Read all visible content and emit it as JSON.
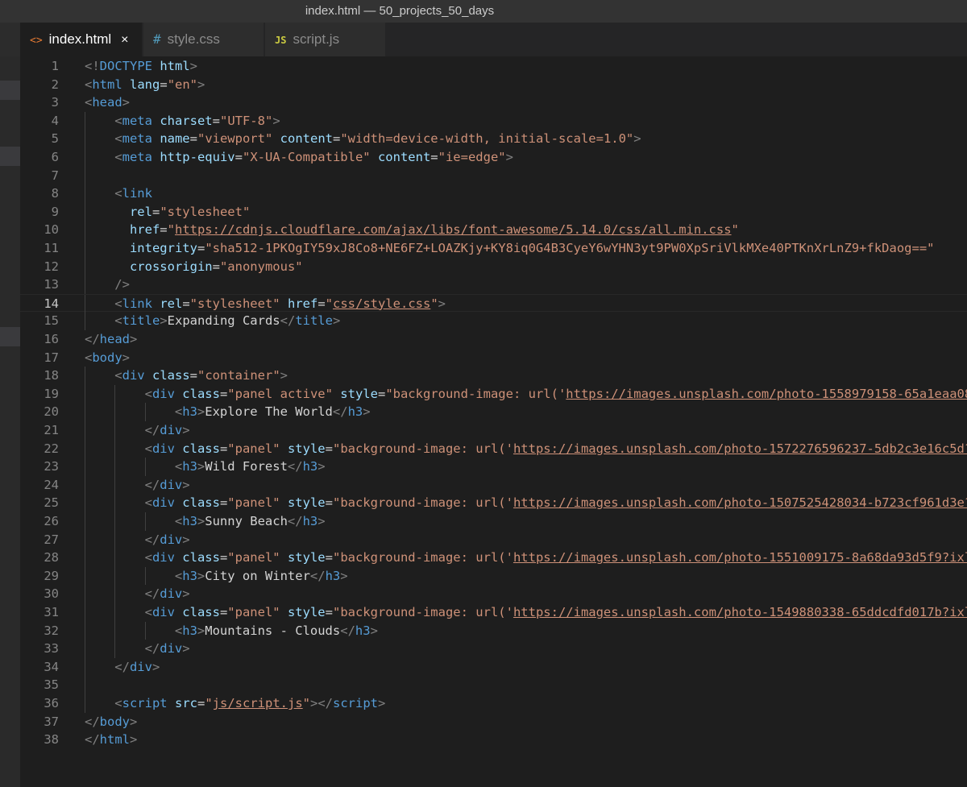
{
  "window": {
    "title": "index.html — 50_projects_50_days"
  },
  "tabs": [
    {
      "label": "index.html",
      "icon": "<>",
      "icon_name": "html-file-icon",
      "active": true,
      "close": "×"
    },
    {
      "label": "style.css",
      "icon": "#",
      "icon_name": "css-file-icon",
      "active": false
    },
    {
      "label": "script.js",
      "icon": "JS",
      "icon_name": "js-file-icon",
      "active": false
    }
  ],
  "editor": {
    "current_line": 14,
    "lines": [
      {
        "n": "1",
        "indent": 0,
        "tokens": [
          [
            "punct",
            "<!"
          ],
          [
            "tag",
            "DOCTYPE"
          ],
          [
            "text",
            " "
          ],
          [
            "attr",
            "html"
          ],
          [
            "punct",
            ">"
          ]
        ]
      },
      {
        "n": "2",
        "indent": 0,
        "tokens": [
          [
            "punct",
            "<"
          ],
          [
            "tag",
            "html"
          ],
          [
            "text",
            " "
          ],
          [
            "attr",
            "lang"
          ],
          [
            "text",
            "="
          ],
          [
            "str",
            "\"en\""
          ],
          [
            "punct",
            ">"
          ]
        ]
      },
      {
        "n": "3",
        "indent": 0,
        "tokens": [
          [
            "punct",
            "<"
          ],
          [
            "tag",
            "head"
          ],
          [
            "punct",
            ">"
          ]
        ]
      },
      {
        "n": "4",
        "indent": 1,
        "tokens": [
          [
            "punct",
            "<"
          ],
          [
            "tag",
            "meta"
          ],
          [
            "text",
            " "
          ],
          [
            "attr",
            "charset"
          ],
          [
            "text",
            "="
          ],
          [
            "str",
            "\"UTF-8\""
          ],
          [
            "punct",
            ">"
          ]
        ]
      },
      {
        "n": "5",
        "indent": 1,
        "tokens": [
          [
            "punct",
            "<"
          ],
          [
            "tag",
            "meta"
          ],
          [
            "text",
            " "
          ],
          [
            "attr",
            "name"
          ],
          [
            "text",
            "="
          ],
          [
            "str",
            "\"viewport\""
          ],
          [
            "text",
            " "
          ],
          [
            "attr",
            "content"
          ],
          [
            "text",
            "="
          ],
          [
            "str",
            "\"width=device-width, initial-scale=1.0\""
          ],
          [
            "punct",
            ">"
          ]
        ]
      },
      {
        "n": "6",
        "indent": 1,
        "tokens": [
          [
            "punct",
            "<"
          ],
          [
            "tag",
            "meta"
          ],
          [
            "text",
            " "
          ],
          [
            "attr",
            "http-equiv"
          ],
          [
            "text",
            "="
          ],
          [
            "str",
            "\"X-UA-Compatible\""
          ],
          [
            "text",
            " "
          ],
          [
            "attr",
            "content"
          ],
          [
            "text",
            "="
          ],
          [
            "str",
            "\"ie=edge\""
          ],
          [
            "punct",
            ">"
          ]
        ]
      },
      {
        "n": "7",
        "indent": 1,
        "tokens": []
      },
      {
        "n": "8",
        "indent": 1,
        "tokens": [
          [
            "punct",
            "<"
          ],
          [
            "tag",
            "link"
          ]
        ]
      },
      {
        "n": "9",
        "indent": 1,
        "tokens": [
          [
            "text",
            "  "
          ],
          [
            "attr",
            "rel"
          ],
          [
            "text",
            "="
          ],
          [
            "str",
            "\"stylesheet\""
          ]
        ]
      },
      {
        "n": "10",
        "indent": 1,
        "tokens": [
          [
            "text",
            "  "
          ],
          [
            "attr",
            "href"
          ],
          [
            "text",
            "="
          ],
          [
            "str",
            "\""
          ],
          [
            "url",
            "https://cdnjs.cloudflare.com/ajax/libs/font-awesome/5.14.0/css/all.min.css"
          ],
          [
            "str",
            "\""
          ]
        ]
      },
      {
        "n": "11",
        "indent": 1,
        "tokens": [
          [
            "text",
            "  "
          ],
          [
            "attr",
            "integrity"
          ],
          [
            "text",
            "="
          ],
          [
            "str",
            "\"sha512-1PKOgIY59xJ8Co8+NE6FZ+LOAZKjy+KY8iq0G4B3CyeY6wYHN3yt9PW0XpSriVlkMXe40PTKnXrLnZ9+fkDaog==\""
          ]
        ]
      },
      {
        "n": "12",
        "indent": 1,
        "tokens": [
          [
            "text",
            "  "
          ],
          [
            "attr",
            "crossorigin"
          ],
          [
            "text",
            "="
          ],
          [
            "str",
            "\"anonymous\""
          ]
        ]
      },
      {
        "n": "13",
        "indent": 1,
        "tokens": [
          [
            "punct",
            "/>"
          ]
        ]
      },
      {
        "n": "14",
        "indent": 1,
        "tokens": [
          [
            "punct",
            "<"
          ],
          [
            "tag",
            "link"
          ],
          [
            "text",
            " "
          ],
          [
            "attr",
            "rel"
          ],
          [
            "text",
            "="
          ],
          [
            "str",
            "\"stylesheet\""
          ],
          [
            "text",
            " "
          ],
          [
            "attr",
            "href"
          ],
          [
            "text",
            "="
          ],
          [
            "str",
            "\""
          ],
          [
            "url",
            "css/style.css"
          ],
          [
            "str",
            "\""
          ],
          [
            "punct",
            ">"
          ]
        ]
      },
      {
        "n": "15",
        "indent": 1,
        "tokens": [
          [
            "punct",
            "<"
          ],
          [
            "tag",
            "title"
          ],
          [
            "punct",
            ">"
          ],
          [
            "text",
            "Expanding Cards"
          ],
          [
            "punct",
            "</"
          ],
          [
            "tag",
            "title"
          ],
          [
            "punct",
            ">"
          ]
        ]
      },
      {
        "n": "16",
        "indent": 0,
        "tokens": [
          [
            "punct",
            "</"
          ],
          [
            "tag",
            "head"
          ],
          [
            "punct",
            ">"
          ]
        ]
      },
      {
        "n": "17",
        "indent": 0,
        "tokens": [
          [
            "punct",
            "<"
          ],
          [
            "tag",
            "body"
          ],
          [
            "punct",
            ">"
          ]
        ]
      },
      {
        "n": "18",
        "indent": 1,
        "tokens": [
          [
            "punct",
            "<"
          ],
          [
            "tag",
            "div"
          ],
          [
            "text",
            " "
          ],
          [
            "attr",
            "class"
          ],
          [
            "text",
            "="
          ],
          [
            "str",
            "\"container\""
          ],
          [
            "punct",
            ">"
          ]
        ]
      },
      {
        "n": "19",
        "indent": 2,
        "tokens": [
          [
            "punct",
            "<"
          ],
          [
            "tag",
            "div"
          ],
          [
            "text",
            " "
          ],
          [
            "attr",
            "class"
          ],
          [
            "text",
            "="
          ],
          [
            "str",
            "\"panel active\""
          ],
          [
            "text",
            " "
          ],
          [
            "attr",
            "style"
          ],
          [
            "text",
            "="
          ],
          [
            "str",
            "\"background-image: url('"
          ],
          [
            "url",
            "https://images.unsplash.com/photo-1558979158-65a1eaa08691"
          ]
        ]
      },
      {
        "n": "20",
        "indent": 3,
        "tokens": [
          [
            "punct",
            "<"
          ],
          [
            "tag",
            "h3"
          ],
          [
            "punct",
            ">"
          ],
          [
            "text",
            "Explore The World"
          ],
          [
            "punct",
            "</"
          ],
          [
            "tag",
            "h3"
          ],
          [
            "punct",
            ">"
          ]
        ]
      },
      {
        "n": "21",
        "indent": 2,
        "tokens": [
          [
            "punct",
            "</"
          ],
          [
            "tag",
            "div"
          ],
          [
            "punct",
            ">"
          ]
        ]
      },
      {
        "n": "22",
        "indent": 2,
        "tokens": [
          [
            "punct",
            "<"
          ],
          [
            "tag",
            "div"
          ],
          [
            "text",
            " "
          ],
          [
            "attr",
            "class"
          ],
          [
            "text",
            "="
          ],
          [
            "str",
            "\"panel\""
          ],
          [
            "text",
            " "
          ],
          [
            "attr",
            "style"
          ],
          [
            "text",
            "="
          ],
          [
            "str",
            "\"background-image: url('"
          ],
          [
            "url",
            "https://images.unsplash.com/photo-1572276596237-5db2c3e16c5d?ixl"
          ]
        ]
      },
      {
        "n": "23",
        "indent": 3,
        "tokens": [
          [
            "punct",
            "<"
          ],
          [
            "tag",
            "h3"
          ],
          [
            "punct",
            ">"
          ],
          [
            "text",
            "Wild Forest"
          ],
          [
            "punct",
            "</"
          ],
          [
            "tag",
            "h3"
          ],
          [
            "punct",
            ">"
          ]
        ]
      },
      {
        "n": "24",
        "indent": 2,
        "tokens": [
          [
            "punct",
            "</"
          ],
          [
            "tag",
            "div"
          ],
          [
            "punct",
            ">"
          ]
        ]
      },
      {
        "n": "25",
        "indent": 2,
        "tokens": [
          [
            "punct",
            "<"
          ],
          [
            "tag",
            "div"
          ],
          [
            "text",
            " "
          ],
          [
            "attr",
            "class"
          ],
          [
            "text",
            "="
          ],
          [
            "str",
            "\"panel\""
          ],
          [
            "text",
            " "
          ],
          [
            "attr",
            "style"
          ],
          [
            "text",
            "="
          ],
          [
            "str",
            "\"background-image: url('"
          ],
          [
            "url",
            "https://images.unsplash.com/photo-1507525428034-b723cf961d3e?ixl"
          ]
        ]
      },
      {
        "n": "26",
        "indent": 3,
        "tokens": [
          [
            "punct",
            "<"
          ],
          [
            "tag",
            "h3"
          ],
          [
            "punct",
            ">"
          ],
          [
            "text",
            "Sunny Beach"
          ],
          [
            "punct",
            "</"
          ],
          [
            "tag",
            "h3"
          ],
          [
            "punct",
            ">"
          ]
        ]
      },
      {
        "n": "27",
        "indent": 2,
        "tokens": [
          [
            "punct",
            "</"
          ],
          [
            "tag",
            "div"
          ],
          [
            "punct",
            ">"
          ]
        ]
      },
      {
        "n": "28",
        "indent": 2,
        "tokens": [
          [
            "punct",
            "<"
          ],
          [
            "tag",
            "div"
          ],
          [
            "text",
            " "
          ],
          [
            "attr",
            "class"
          ],
          [
            "text",
            "="
          ],
          [
            "str",
            "\"panel\""
          ],
          [
            "text",
            " "
          ],
          [
            "attr",
            "style"
          ],
          [
            "text",
            "="
          ],
          [
            "str",
            "\"background-image: url('"
          ],
          [
            "url",
            "https://images.unsplash.com/photo-1551009175-8a68da93d5f9?ixlib="
          ]
        ]
      },
      {
        "n": "29",
        "indent": 3,
        "tokens": [
          [
            "punct",
            "<"
          ],
          [
            "tag",
            "h3"
          ],
          [
            "punct",
            ">"
          ],
          [
            "text",
            "City on Winter"
          ],
          [
            "punct",
            "</"
          ],
          [
            "tag",
            "h3"
          ],
          [
            "punct",
            ">"
          ]
        ]
      },
      {
        "n": "30",
        "indent": 2,
        "tokens": [
          [
            "punct",
            "</"
          ],
          [
            "tag",
            "div"
          ],
          [
            "punct",
            ">"
          ]
        ]
      },
      {
        "n": "31",
        "indent": 2,
        "tokens": [
          [
            "punct",
            "<"
          ],
          [
            "tag",
            "div"
          ],
          [
            "text",
            " "
          ],
          [
            "attr",
            "class"
          ],
          [
            "text",
            "="
          ],
          [
            "str",
            "\"panel\""
          ],
          [
            "text",
            " "
          ],
          [
            "attr",
            "style"
          ],
          [
            "text",
            "="
          ],
          [
            "str",
            "\"background-image: url('"
          ],
          [
            "url",
            "https://images.unsplash.com/photo-1549880338-65ddcdfd017b?ixlib="
          ]
        ]
      },
      {
        "n": "32",
        "indent": 3,
        "tokens": [
          [
            "punct",
            "<"
          ],
          [
            "tag",
            "h3"
          ],
          [
            "punct",
            ">"
          ],
          [
            "text",
            "Mountains - Clouds"
          ],
          [
            "punct",
            "</"
          ],
          [
            "tag",
            "h3"
          ],
          [
            "punct",
            ">"
          ]
        ]
      },
      {
        "n": "33",
        "indent": 2,
        "tokens": [
          [
            "punct",
            "</"
          ],
          [
            "tag",
            "div"
          ],
          [
            "punct",
            ">"
          ]
        ]
      },
      {
        "n": "34",
        "indent": 1,
        "tokens": [
          [
            "punct",
            "</"
          ],
          [
            "tag",
            "div"
          ],
          [
            "punct",
            ">"
          ]
        ]
      },
      {
        "n": "35",
        "indent": 1,
        "tokens": []
      },
      {
        "n": "36",
        "indent": 1,
        "tokens": [
          [
            "punct",
            "<"
          ],
          [
            "tag",
            "script"
          ],
          [
            "text",
            " "
          ],
          [
            "attr",
            "src"
          ],
          [
            "text",
            "="
          ],
          [
            "str",
            "\""
          ],
          [
            "url",
            "js/script.js"
          ],
          [
            "str",
            "\""
          ],
          [
            "punct",
            "></"
          ],
          [
            "tag",
            "script"
          ],
          [
            "punct",
            ">"
          ]
        ]
      },
      {
        "n": "37",
        "indent": 0,
        "tokens": [
          [
            "punct",
            "</"
          ],
          [
            "tag",
            "body"
          ],
          [
            "punct",
            ">"
          ]
        ]
      },
      {
        "n": "38",
        "indent": 0,
        "tokens": [
          [
            "punct",
            "</"
          ],
          [
            "tag",
            "html"
          ],
          [
            "punct",
            ">"
          ]
        ]
      }
    ]
  },
  "colors": {
    "tag": "#569cd6",
    "attr": "#9cdcfe",
    "string": "#ce9178",
    "text": "#d4d4d4",
    "punct": "#808080",
    "background": "#1e1e1e"
  }
}
